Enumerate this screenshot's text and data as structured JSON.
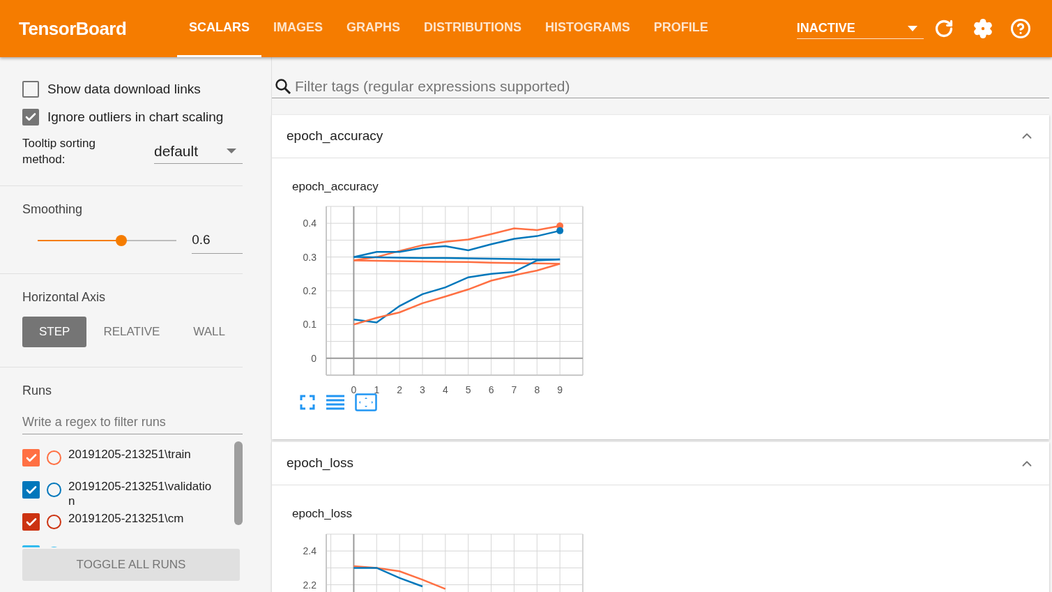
{
  "app_title": "TensorBoard",
  "tabs": [
    {
      "label": "SCALARS",
      "selected": true
    },
    {
      "label": "IMAGES",
      "selected": false
    },
    {
      "label": "GRAPHS",
      "selected": false
    },
    {
      "label": "DISTRIBUTIONS",
      "selected": false
    },
    {
      "label": "HISTOGRAMS",
      "selected": false
    },
    {
      "label": "PROFILE",
      "selected": false
    }
  ],
  "plugin_select": {
    "value": "INACTIVE"
  },
  "sidebar": {
    "options": [
      {
        "label": "Show data download links",
        "checked": false
      },
      {
        "label": "Ignore outliers in chart scaling",
        "checked": true
      }
    ],
    "tooltip_sorting": {
      "label": "Tooltip sorting method:",
      "value": "default"
    },
    "smoothing": {
      "label": "Smoothing",
      "level": 0.6,
      "reading": "0.6"
    },
    "horizontal_axis": {
      "label": "Horizontal Axis",
      "options": [
        {
          "label": "STEP",
          "selected": true
        },
        {
          "label": "RELATIVE",
          "selected": false
        },
        {
          "label": "WALL",
          "selected": false
        }
      ]
    },
    "runs": {
      "label": "Runs",
      "filter_placeholder": "Write a regex to filter runs",
      "items": [
        {
          "name": "20191205-213251\\train",
          "checked": true,
          "color": "#ff7043"
        },
        {
          "name": "20191205-213251\\validatio\nn",
          "checked": true,
          "color": "#0077bb"
        },
        {
          "name": "20191205-213251\\cm",
          "checked": true,
          "color": "#cc3311"
        },
        {
          "color": "#33bbee"
        }
      ],
      "toggle_button": "TOGGLE ALL RUNS"
    }
  },
  "filter": {
    "placeholder": "Filter tags (regular expressions supported)"
  },
  "cards": [
    {
      "title": "epoch_accuracy",
      "expanded": true,
      "chart_tools": true,
      "chart_data": {
        "type": "line",
        "title": "epoch_accuracy",
        "grid": true,
        "x": [
          0,
          1,
          2,
          3,
          4,
          5,
          6,
          7,
          8,
          9
        ],
        "xlim": [
          -1.2,
          10
        ],
        "ylim": [
          -0.05,
          0.45
        ],
        "xticks": [
          0,
          1,
          2,
          3,
          4,
          5,
          6,
          7,
          8,
          9
        ],
        "yticks": [
          0,
          0.1,
          0.2,
          0.3,
          0.4
        ],
        "series": [
          {
            "color": "#ff7043",
            "values": [
              0.29,
              0.3,
              0.318,
              0.335,
              0.345,
              0.352,
              0.368,
              0.385,
              0.38,
              0.392
            ]
          },
          {
            "color": "#0077bb",
            "values": [
              0.3,
              0.315,
              0.315,
              0.327,
              0.332,
              0.32,
              0.338,
              0.354,
              0.362,
              0.378
            ]
          },
          {
            "color": "#0077bb",
            "values": [
              0.3,
              0.299,
              0.298,
              0.297,
              0.297,
              0.296,
              0.295,
              0.294,
              0.293,
              0.293
            ]
          },
          {
            "color": "#ff7043",
            "values": [
              0.29,
              0.289,
              0.288,
              0.287,
              0.286,
              0.285,
              0.283,
              0.282,
              0.281,
              0.28
            ]
          },
          {
            "color": "#0077bb",
            "values": [
              0.115,
              0.106,
              0.155,
              0.19,
              0.21,
              0.24,
              0.25,
              0.256,
              0.29,
              0.293
            ]
          },
          {
            "color": "#ff7043",
            "values": [
              0.1,
              0.12,
              0.136,
              0.163,
              0.183,
              0.204,
              0.23,
              0.246,
              0.26,
              0.28
            ]
          }
        ]
      }
    },
    {
      "title": "epoch_loss",
      "expanded": true,
      "chart_data": {
        "type": "line",
        "title": "epoch_loss",
        "grid": true,
        "x": [
          0,
          1,
          2,
          3,
          4
        ],
        "xlim": [
          -1.2,
          10
        ],
        "ylim": [
          1.5,
          2.5
        ],
        "yticks": [
          2.2,
          2.4
        ],
        "series": [
          {
            "color": "#ff7043",
            "values": [
              2.31,
              2.3,
              2.28,
              2.23,
              2.175
            ]
          },
          {
            "color": "#0077bb",
            "values": [
              2.3,
              2.3,
              2.24,
              2.19,
              null
            ]
          }
        ]
      }
    }
  ]
}
